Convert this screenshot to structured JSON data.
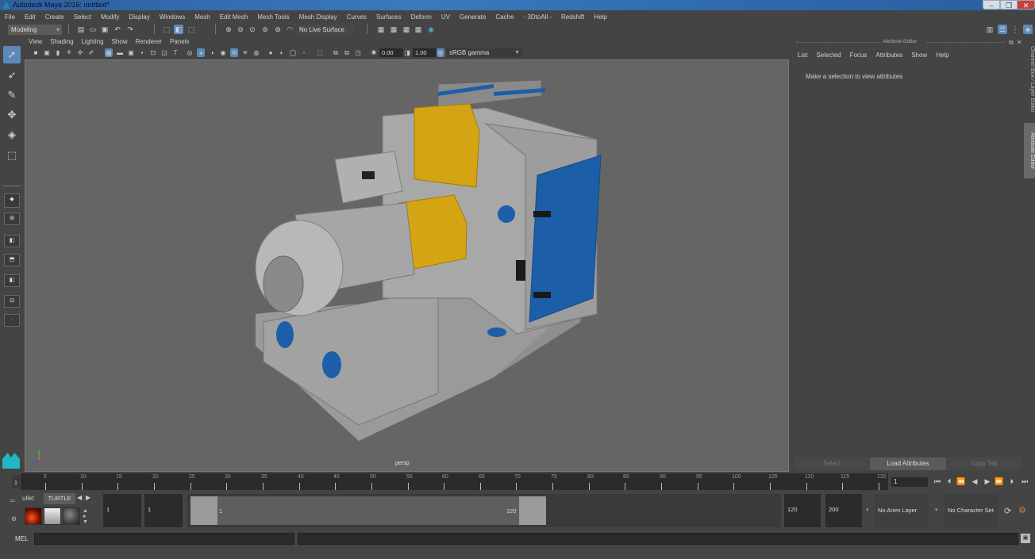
{
  "window": {
    "title": "Autodesk Maya 2016: untitled*",
    "controls": {
      "minimize": "–",
      "maximize": "❐",
      "close": "✕"
    }
  },
  "menubar": [
    "File",
    "Edit",
    "Create",
    "Select",
    "Modify",
    "Display",
    "Windows",
    "Mesh",
    "Edit Mesh",
    "Mesh Tools",
    "Mesh Display",
    "Curves",
    "Surfaces",
    "Deform",
    "UV",
    "Generate",
    "Cache",
    "- 3DtoAll -",
    "Redshift",
    "Help"
  ],
  "statusline": {
    "mode": "Modeling",
    "live_surface": "No Live Surface"
  },
  "viewport_panel": {
    "menu": [
      "View",
      "Shading",
      "Lighting",
      "Show",
      "Renderer",
      "Panels"
    ],
    "exposure": "0.00",
    "gamma": "1.00",
    "color_space": "sRGB gamma",
    "camera_label": "persp"
  },
  "attribute_editor": {
    "title": "Attribute Editor",
    "menu": [
      "List",
      "Selected",
      "Focus",
      "Attributes",
      "Show",
      "Help"
    ],
    "message": "Make a selection to view attributes",
    "buttons": {
      "select": "Select",
      "load": "Load Attributes",
      "copy_tab": "Copy Tab"
    }
  },
  "side_tabs": {
    "channel_box": "Channel Box / Layer Editor",
    "attribute_editor": "Attribute Editor"
  },
  "timeline": {
    "start_label": "1",
    "ticks": [
      "5",
      "10",
      "15",
      "20",
      "25",
      "30",
      "35",
      "40",
      "45",
      "50",
      "55",
      "60",
      "65",
      "70",
      "75",
      "80",
      "85",
      "90",
      "95",
      "100",
      "105",
      "110",
      "115",
      "120"
    ],
    "current_frame": "1"
  },
  "range": {
    "shelf_tabs": {
      "bullet": "ullet",
      "turtle": "TURTLE"
    },
    "start_time": "1",
    "playback_start": "1",
    "range_start_label": "1",
    "range_end_label": "120",
    "playback_end": "120",
    "end_time": "200",
    "anim_layer": "No Anim Layer",
    "character_set": "No Character Set"
  },
  "cmdline": {
    "label": "MEL",
    "value": ""
  },
  "colors": {
    "accent": "#5c89b8",
    "viewport_bg": "#656565",
    "panel_bg": "#444444",
    "machine_blue": "#1c5fa8",
    "machine_yellow": "#d4a414"
  }
}
